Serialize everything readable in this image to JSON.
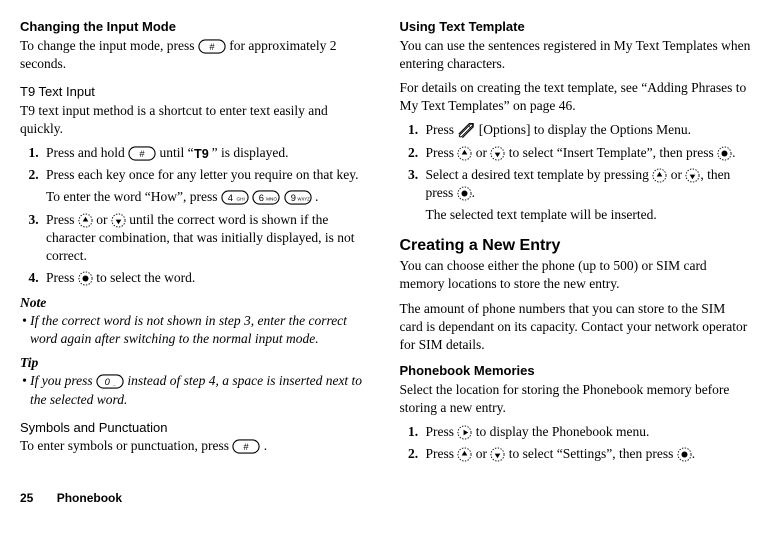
{
  "left": {
    "h1": "Changing the Input Mode",
    "p1a": "To change the input mode, press ",
    "p1b": " for approximately 2 seconds.",
    "h2": "T9 Text Input",
    "p2": "T9 text input method is a shortcut to enter text easily and quickly.",
    "s1a": "Press and hold ",
    "s1b": " until “",
    "s1c": "” is displayed.",
    "s2": "Press each key once for any letter you require on that key.",
    "s2suba": "To enter the word “How”, press ",
    "s2subb": ".",
    "s3a": "Press ",
    "s3b": " or ",
    "s3c": " until the correct word is shown if the character combination, that was initially displayed, is not correct.",
    "s4a": "Press ",
    "s4b": " to select the word.",
    "noteLabel": "Note",
    "note": "• If the correct word is not shown in step 3, enter the correct word again after switching to the normal input mode.",
    "tipLabel": "Tip",
    "tipa": "• If you press ",
    "tipb": " instead of step 4, a space is inserted next to the selected word.",
    "h3": "Symbols and Punctuation",
    "p3a": "To enter symbols or punctuation, press ",
    "p3b": "."
  },
  "right": {
    "h1": "Using Text Template",
    "p1": "You can use the sentences registered in My Text Templates when entering characters.",
    "p2": "For details on creating the text template, see “Adding Phrases to My Text Templates” on page 46.",
    "s1a": "Press ",
    "s1b": " [Options] to display the Options Menu.",
    "s2a": "Press ",
    "s2b": " or ",
    "s2c": " to select “Insert Template”, then press ",
    "s2d": ".",
    "s3a": "Select a desired text template by pressing ",
    "s3b": " or ",
    "s3c": ", then press ",
    "s3d": ".",
    "s3sub": "The selected text template will be inserted.",
    "h2": "Creating a New Entry",
    "p3": "You can choose either the phone (up to 500) or SIM card memory locations to store the new entry.",
    "p4": "The amount of phone numbers that you can store to the SIM card is dependant on its capacity. Contact your network operator for SIM details.",
    "h3": "Phonebook Memories",
    "p5": "Select the location for storing the Phonebook memory before storing a new entry.",
    "s4a": "Press ",
    "s4b": " to display the Phonebook menu.",
    "s5a": "Press ",
    "s5b": " or ",
    "s5c": " to select “Settings”, then press ",
    "s5d": "."
  },
  "footer": {
    "page": "25",
    "section": "Phonebook"
  }
}
